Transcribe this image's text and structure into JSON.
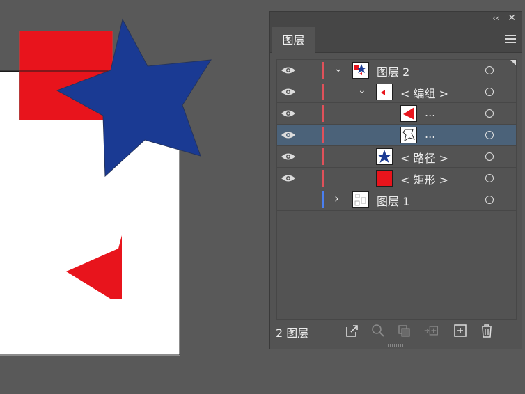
{
  "panel": {
    "tab_label": "图层",
    "footer_count": "2 图层",
    "collapse_glyph": "‹‹",
    "close_glyph": "✕"
  },
  "layers": [
    {
      "label": "图层 2",
      "expand": "⌄",
      "bar_color": "#e0515a",
      "visible": true,
      "selected": false
    },
    {
      "label": "< 编组 >",
      "expand": "⌄",
      "bar_color": "#e0515a",
      "visible": true,
      "selected": false
    },
    {
      "label": "...",
      "expand": "",
      "bar_color": "#e0515a",
      "visible": true,
      "selected": false
    },
    {
      "label": "...",
      "expand": "",
      "bar_color": "#e0515a",
      "visible": true,
      "selected": true
    },
    {
      "label": "< 路径 >",
      "expand": "",
      "bar_color": "#e0515a",
      "visible": true,
      "selected": false
    },
    {
      "label": "< 矩形 >",
      "expand": "",
      "bar_color": "#e0515a",
      "visible": true,
      "selected": false
    },
    {
      "label": "图层 1",
      "expand": "›",
      "bar_color": "#4a7ff0",
      "visible": false,
      "selected": false
    }
  ],
  "colors": {
    "workspace": "#595959",
    "panel_bg": "#535353",
    "selected_row": "#4b6279",
    "red": "#e8141c",
    "blue": "#1a3a93",
    "layer1_color": "#4a7ff0",
    "layer2_color": "#e0515a"
  },
  "icons": [
    "eye-icon",
    "chevron-down-icon",
    "chevron-right-icon",
    "target-circle-icon",
    "hamburger-menu-icon",
    "export-icon",
    "search-icon",
    "clipping-mask-icon",
    "move-to-layer-icon",
    "new-layer-icon",
    "trash-icon"
  ]
}
